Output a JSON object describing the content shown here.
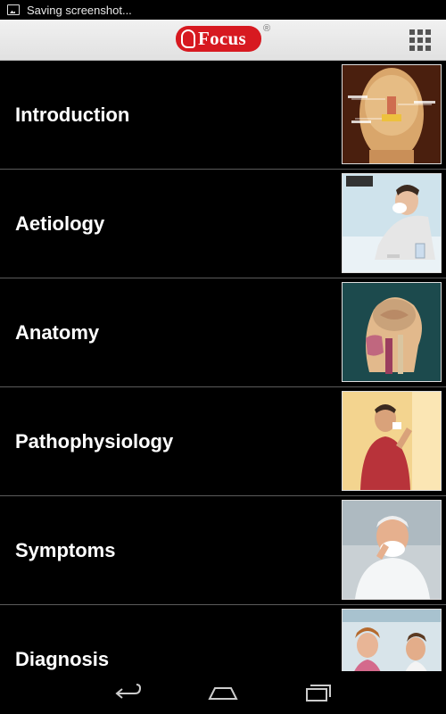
{
  "status_bar": {
    "notification": "Saving screenshot..."
  },
  "app_bar": {
    "logo_text": "Focus",
    "registered_mark": "®",
    "menu_icon": "grid-icon"
  },
  "topics": [
    {
      "label": "Introduction",
      "thumbnail": "sinus-anatomy-image"
    },
    {
      "label": "Aetiology",
      "thumbnail": "man-sneezing-image"
    },
    {
      "label": "Anatomy",
      "thumbnail": "head-cross-section-image"
    },
    {
      "label": "Pathophysiology",
      "thumbnail": "man-blowing-nose-image"
    },
    {
      "label": "Symptoms",
      "thumbnail": "elderly-man-tissue-image"
    },
    {
      "label": "Diagnosis",
      "thumbnail": "doctor-consultation-image"
    }
  ],
  "nav_bar": {
    "back": "back-icon",
    "home": "home-icon",
    "recents": "recents-icon"
  }
}
